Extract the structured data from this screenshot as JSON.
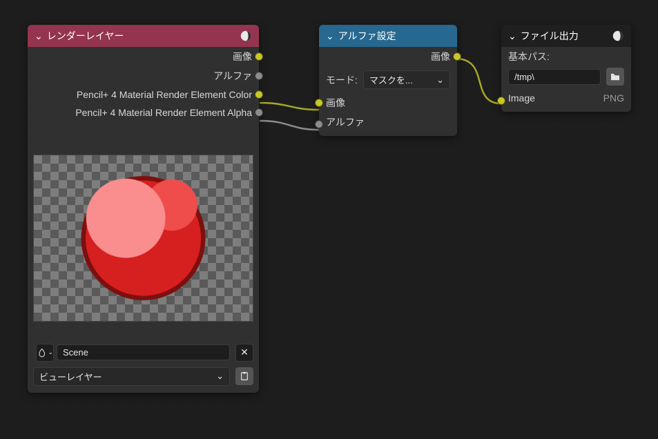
{
  "nodes": {
    "render_layers": {
      "title": "レンダーレイヤー",
      "outputs": {
        "image": "画像",
        "alpha": "アルファ",
        "p4_color": "Pencil+ 4 Material Render Element Color",
        "p4_alpha": "Pencil+ 4 Material Render Element Alpha"
      },
      "scene_field": "Scene",
      "view_layer_field": "ビューレイヤー"
    },
    "set_alpha": {
      "title": "アルファ設定",
      "outputs": {
        "image": "画像"
      },
      "mode_label": "モード:",
      "mode_value": "マスクを...",
      "inputs": {
        "image": "画像",
        "alpha": "アルファ"
      }
    },
    "file_output": {
      "title": "ファイル出力",
      "base_path_label": "基本パス:",
      "base_path_value": "/tmp\\",
      "input_label": "Image",
      "format": "PNG"
    }
  },
  "icons": {
    "chevron_down": "⌄",
    "sphere": "sphere",
    "folder": "folder",
    "x": "✕",
    "copy": "copy",
    "drop": "drop"
  }
}
